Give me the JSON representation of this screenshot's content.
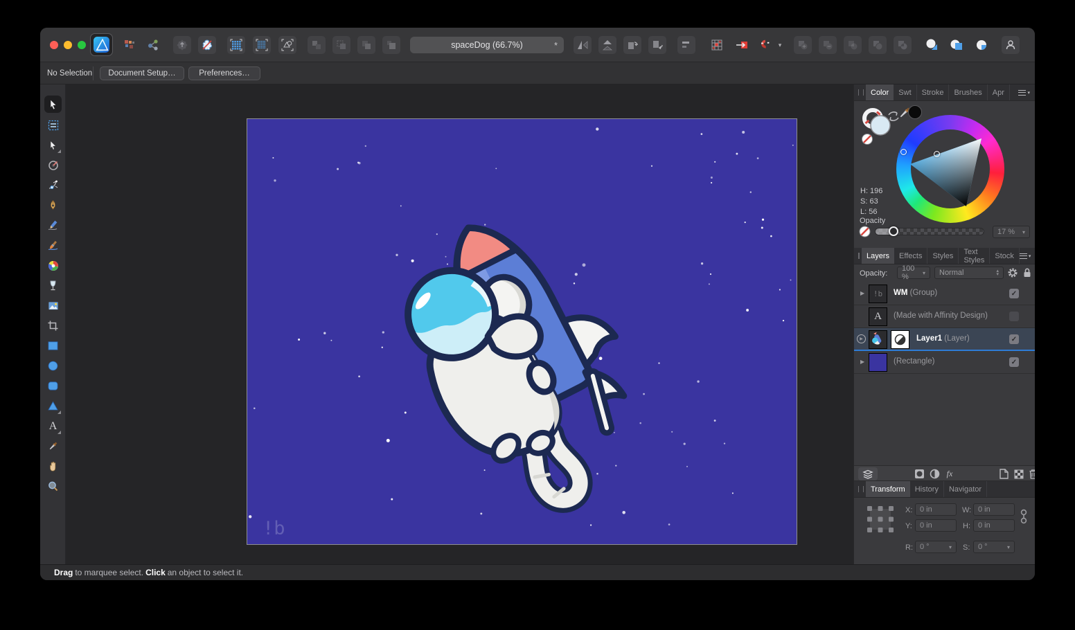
{
  "colors": {
    "window_bg": "#39393b",
    "panel_bg": "#3a3a3d",
    "canvas_area_bg": "#252527",
    "canvas_bg": "#3a34a0",
    "selection_blue": "#2e7cd6",
    "active_row_bg": "#3b4554"
  },
  "artwork_colors": {
    "outline": "#1c2951",
    "rocket_light": "#7e9ae3",
    "rocket_dark": "#5c7ed6",
    "nose_cone": "#f28b83",
    "window_white": "#f4f4f2",
    "window_shade": "#d9d9d4",
    "suit_white": "#efefec",
    "stripe_red": "#e25b50",
    "stripe_pink": "#ef968e",
    "helmet_glass": "#47c5ea",
    "helmet_pale": "#cdeef8",
    "dog_brown": "#aa7b51",
    "dog_ear": "#8d6140"
  },
  "titlebar": {
    "document_title": "spaceDog (66.7%)",
    "modified_indicator": "*"
  },
  "context_toolbar": {
    "selection_status": "No Selection",
    "document_setup": "Document Setup…",
    "preferences": "Preferences…"
  },
  "color_panel": {
    "tabs": {
      "color": "Color",
      "swatches": "Swt",
      "stroke": "Stroke",
      "brushes": "Brushes",
      "appearance": "Apr"
    },
    "hsl": {
      "h": "H: 196",
      "s": "S: 63",
      "l": "L: 56"
    },
    "opacity_label": "Opacity",
    "opacity_value": "17 %",
    "opacity_percent": 17
  },
  "layers_panel": {
    "tabs": {
      "layers": "Layers",
      "effects": "Effects",
      "styles": "Styles",
      "text_styles": "Text Styles",
      "stock": "Stock"
    },
    "opacity_label": "Opacity:",
    "opacity_value": "100 %",
    "blend_mode": "Normal",
    "fx": "fx",
    "rows": [
      {
        "name": "WM",
        "suffix": "(Group)",
        "thumb_text": "!b",
        "checked": true
      },
      {
        "name": "",
        "suffix": "(Made with Affinity Design)",
        "thumb_text": "A",
        "checked": false
      },
      {
        "name": "Layer1",
        "suffix": "(Layer)",
        "checked": true,
        "selected": true
      },
      {
        "name": "",
        "suffix": "(Rectangle)",
        "checked": true
      }
    ]
  },
  "transform_panel": {
    "tabs": {
      "transform": "Transform",
      "history": "History",
      "navigator": "Navigator"
    },
    "x_label": "X:",
    "x_value": "0 in",
    "y_label": "Y:",
    "y_value": "0 in",
    "w_label": "W:",
    "w_value": "0 in",
    "h_label": "H:",
    "h_value": "0 in",
    "r_label": "R:",
    "r_value": "0 °",
    "s_label": "S:",
    "s_value": "0 °"
  },
  "status_bar": {
    "drag": "Drag",
    "drag_text": " to marquee select. ",
    "click": "Click",
    "click_text": " an object to select it."
  },
  "canvas": {
    "watermark": "!b"
  },
  "icons": {
    "check": "✓",
    "dropdown": "▾",
    "expand": "▶",
    "spin_up": "▴",
    "spin_down": "▾"
  }
}
